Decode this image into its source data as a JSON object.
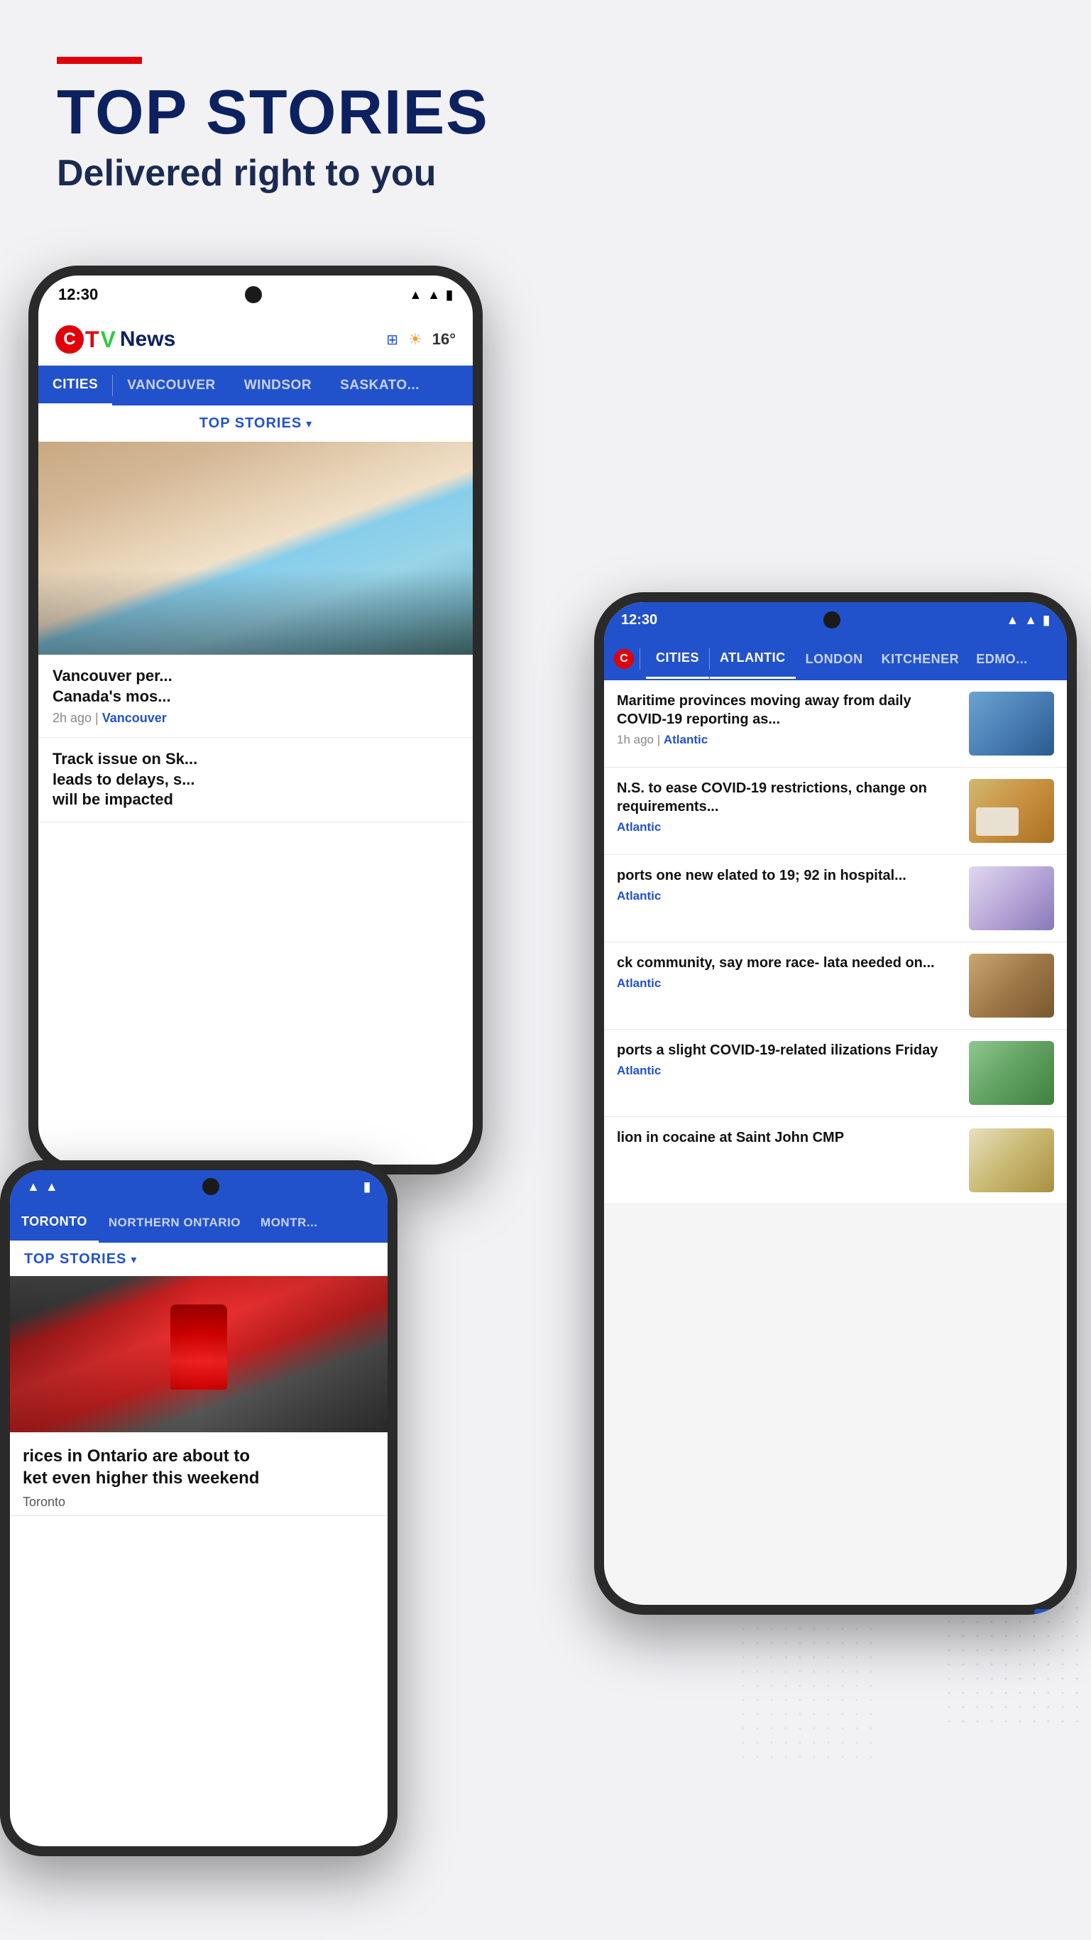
{
  "page": {
    "background_color": "#f2f2f5"
  },
  "header": {
    "red_bar": true,
    "main_title": "TOP STORIES",
    "subtitle": "Delivered right to you"
  },
  "phone1": {
    "status_time": "12:30",
    "logo": {
      "c": "C",
      "t": "T",
      "v": "V",
      "news": "News"
    },
    "weather": "16°",
    "nav_items": [
      "CITIES",
      "VANCOUVER",
      "WINDSOR",
      "SASKATO..."
    ],
    "active_nav": "CITIES",
    "section_label": "TOP STORIES",
    "hero_story": {
      "title": "Vancouver per... Canada's mos...",
      "time": "2h ago",
      "location": "Vancouver"
    },
    "story2": {
      "title": "Track issue on Sk... leads to delays, s... will be impacted",
      "time": "",
      "location": ""
    }
  },
  "phone2": {
    "status_time": "12:30",
    "nav_items": [
      "CITIES",
      "ATLANTIC",
      "LONDON",
      "KITCHENER",
      "EDMO..."
    ],
    "active_nav": "ATLANTIC",
    "stories": [
      {
        "title": "Maritime provinces moving away from daily COVID-19 reporting as...",
        "time": "1h ago",
        "location": "Atlantic",
        "thumb_class": "thumb-blue"
      },
      {
        "title": "N.S. to ease COVID-19 restrictions, change on requirements...",
        "time": "",
        "location": "Atlantic",
        "thumb_class": "thumb-warm"
      },
      {
        "title": "ports one new elated to 19; 92 in hospital...",
        "time": "",
        "location": "Atlantic",
        "thumb_class": "thumb-medical"
      },
      {
        "title": "ck community, say more race- lata needed on...",
        "time": "",
        "location": "Atlantic",
        "thumb_class": "thumb-teal"
      },
      {
        "title": "ports a slight COVID-19-related ilizations Friday",
        "time": "",
        "location": "Atlantic",
        "thumb_class": "thumb-green"
      },
      {
        "title": "lion in cocaine at Saint John CMP",
        "time": "",
        "location": "",
        "thumb_class": "thumb-yellow"
      }
    ]
  },
  "phone3": {
    "nav_items": [
      "TORONTO",
      "NORTHERN ONTARIO",
      "MONTR..."
    ],
    "active_nav": "TORONTO",
    "section_label": "TOP STORIES",
    "story": {
      "title": "rices in Ontario are about to ket even higher this weekend",
      "location": "Toronto"
    }
  },
  "icons": {
    "cast": "⊡",
    "sun": "☀",
    "chevron_down": "▾",
    "wifi": "▲",
    "battery": "▮"
  }
}
